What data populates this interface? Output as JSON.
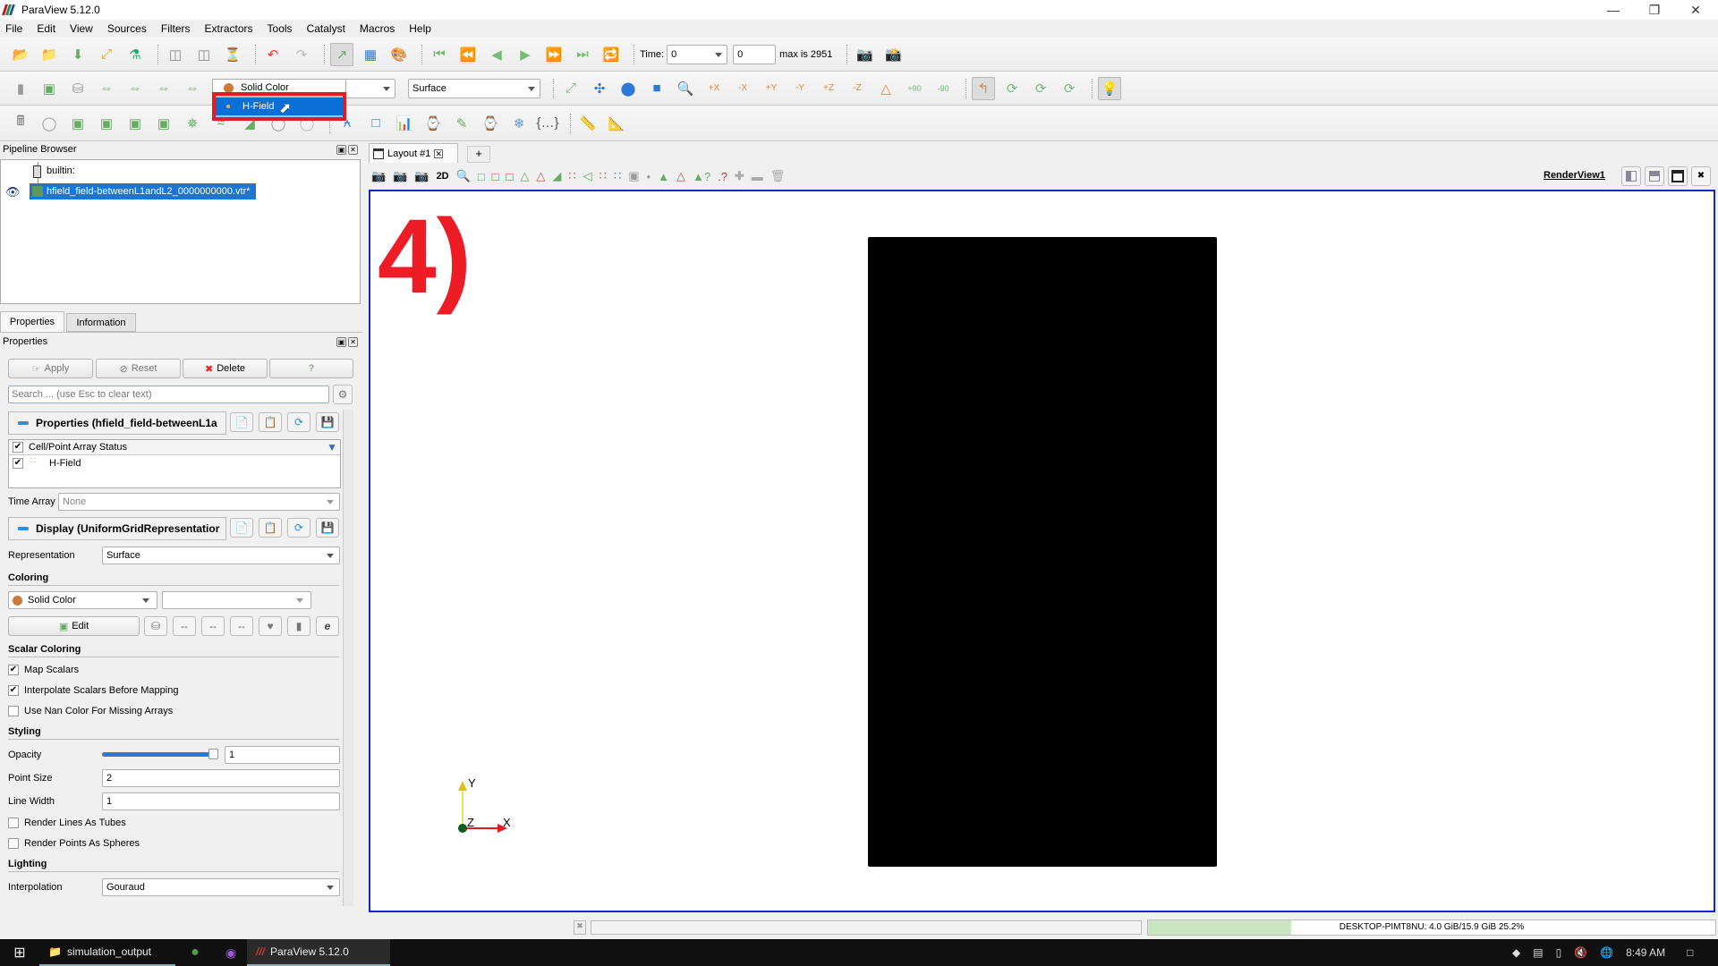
{
  "window": {
    "title": "ParaView 5.12.0",
    "logo_colors": [
      "#c8102e",
      "#2e8b3a",
      "#1d5aa8"
    ]
  },
  "menu": [
    "File",
    "Edit",
    "View",
    "Sources",
    "Filters",
    "Extractors",
    "Tools",
    "Catalyst",
    "Macros",
    "Help"
  ],
  "time_toolbar": {
    "time_label": "Time:",
    "time_value": "0",
    "index_value": "0",
    "max_label": "max is 2951"
  },
  "color_toolbar": {
    "coloring_combo": "Solid Color",
    "dropdown_options": [
      {
        "label": "Solid Color",
        "selected": false
      },
      {
        "label": "H-Field",
        "selected": true
      }
    ],
    "representation_combo": "Surface"
  },
  "camera_toolbar": {
    "rotate_plus": "+90",
    "rotate_minus": "-90",
    "axes_labels": [
      "+X",
      "-X",
      "+Y",
      "-Y",
      "+Z",
      "-Z"
    ]
  },
  "pipeline_browser": {
    "title": "Pipeline Browser",
    "items": [
      {
        "label": "builtin:",
        "selected": false
      },
      {
        "label": "hfield_field-betweenL1andL2_0000000000.vtr*",
        "selected": true
      }
    ]
  },
  "tabs": [
    "Properties",
    "Information"
  ],
  "properties": {
    "title": "Properties",
    "buttons": {
      "apply": "Apply",
      "reset": "Reset",
      "delete": "Delete",
      "help": "?"
    },
    "search_placeholder": "Search ... (use Esc to clear text)",
    "section_properties": "Properties (hfield_field-betweenL1a",
    "array_status_header": "Cell/Point Array Status",
    "arrays": [
      {
        "name": "H-Field",
        "checked": true
      }
    ],
    "time_array_label": "Time Array",
    "time_array_value": "None",
    "section_display": "Display (UniformGridRepresentatior",
    "representation_label": "Representation",
    "representation_value": "Surface",
    "coloring_label": "Coloring",
    "coloring_value": "Solid Color",
    "edit_label": "Edit",
    "scalar_coloring_label": "Scalar Coloring",
    "map_scalars": "Map Scalars",
    "interpolate_scalars": "Interpolate Scalars Before Mapping",
    "nan_color": "Use Nan Color For Missing Arrays",
    "styling_label": "Styling",
    "opacity_label": "Opacity",
    "opacity_value": "1",
    "opacity_fraction": 1.0,
    "point_size_label": "Point Size",
    "point_size_value": "2",
    "line_width_label": "Line Width",
    "line_width_value": "1",
    "tubes": "Render Lines As Tubes",
    "spheres": "Render Points As Spheres",
    "lighting_label": "Lighting",
    "interpolation_label": "Interpolation",
    "interpolation_value": "Gouraud"
  },
  "layout": {
    "tab_label": "Layout #1",
    "add_tab": "+",
    "view_name": "RenderView1",
    "mode_2d": "2D"
  },
  "render": {
    "annotation": "4)",
    "annotation_color": "#ee1c25",
    "object_color": "#000000",
    "axes": {
      "x": "X",
      "y": "Y",
      "z": "Z"
    }
  },
  "status": {
    "memory": "DESKTOP-PIMT8NU: 4.0 GiB/15.9 GiB 25.2%",
    "memory_fraction": 0.252
  },
  "taskbar": {
    "items": [
      "simulation_output",
      "ParaView 5.12.0"
    ],
    "clock": "8:49 AM"
  }
}
